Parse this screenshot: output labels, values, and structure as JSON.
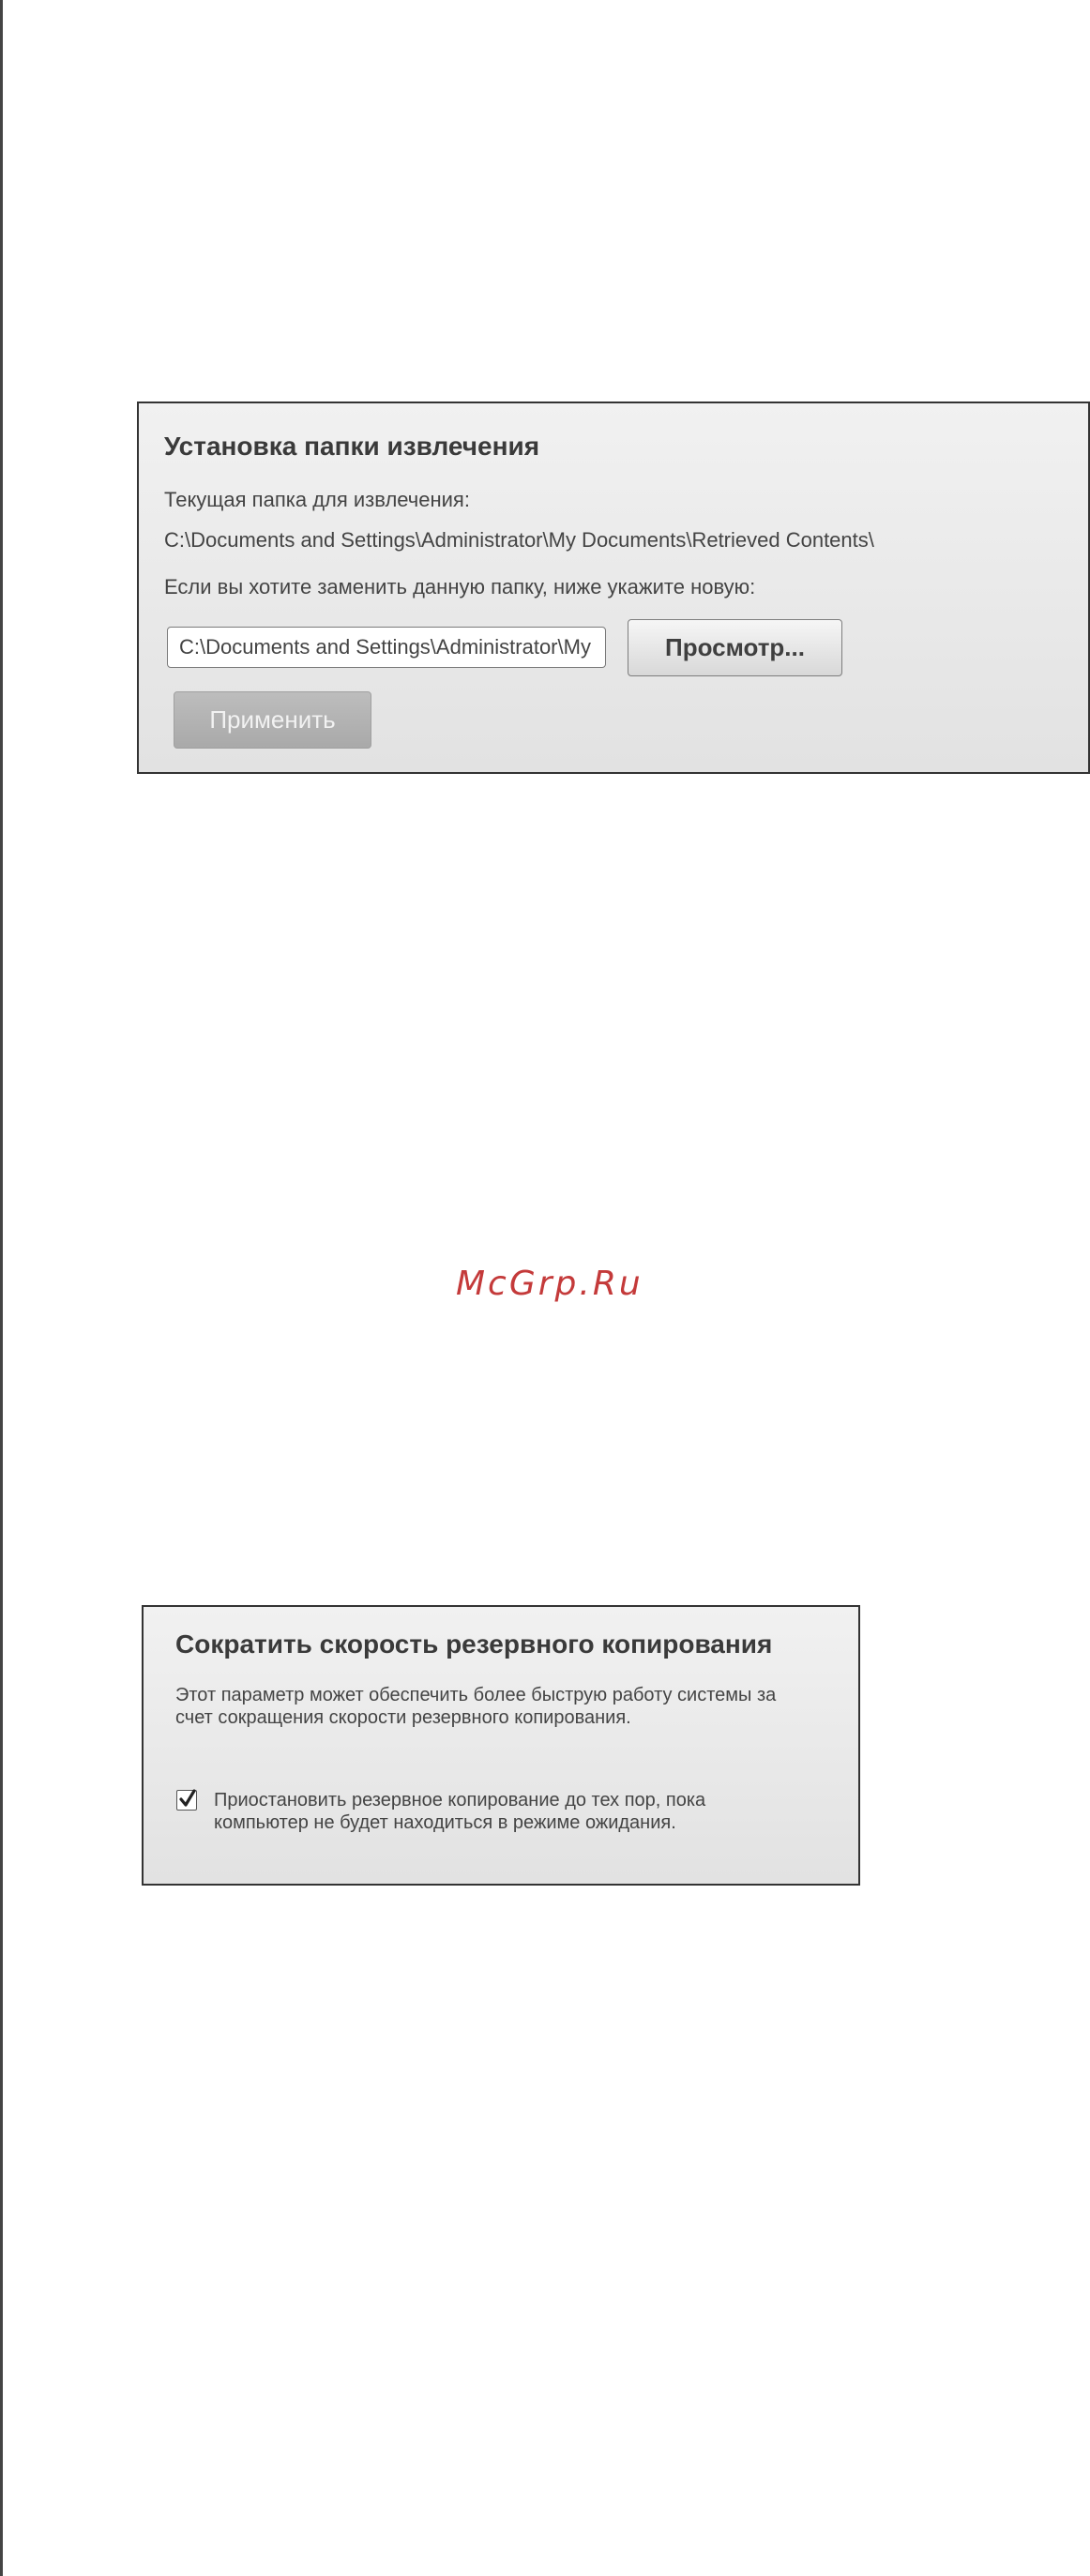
{
  "extract_panel": {
    "title": "Установка папки извлечения",
    "current_folder_label": "Текущая папка для извлечения:",
    "current_folder_path": "C:\\Documents and Settings\\Administrator\\My Documents\\Retrieved Contents\\",
    "change_prompt": "Если вы хотите заменить данную папку, ниже укажите новую:",
    "path_input_value": "C:\\Documents and Settings\\Administrator\\My Documents\\Retrieved Contents\\",
    "browse_label": "Просмотр...",
    "apply_label": "Применить"
  },
  "watermark": "McGrp.Ru",
  "throttle_panel": {
    "title": "Сократить скорость резервного копирования",
    "description": "Этот параметр может обеспечить более быструю работу системы за счет сокращения скорости резервного копирования.",
    "checkbox_label": "Приостановить резервное копирование до тех пор, пока компьютер не будет находиться в режиме ожидания.",
    "checkbox_checked": true
  }
}
